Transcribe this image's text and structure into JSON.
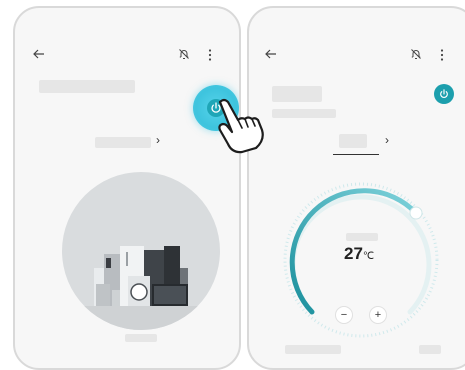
{
  "screens": [
    {
      "id": "before",
      "toolbar": {
        "back_icon": "back-arrow-icon",
        "bell_icon": "bell-icon",
        "more_icon": "more-vertical-icon"
      },
      "power_button": {
        "state": "pressed",
        "icon": "power-icon",
        "color": "#3ec4de"
      },
      "mode_chevron": "›",
      "illustration": "home-appliances-illustration"
    },
    {
      "id": "after",
      "toolbar": {
        "back_icon": "back-arrow-icon",
        "bell_icon": "bell-icon",
        "more_icon": "more-vertical-icon"
      },
      "power_button": {
        "state": "on",
        "icon": "power-icon",
        "color": "#1c9fad"
      },
      "mode_chevron": "›",
      "thermostat": {
        "temperature": "27",
        "unit": "℃",
        "minus_label": "−",
        "plus_label": "+",
        "accent_color": "#1c9fad",
        "track_color": "#d8eef0"
      }
    }
  ],
  "cursor": {
    "icon": "hand-pointer-icon"
  }
}
